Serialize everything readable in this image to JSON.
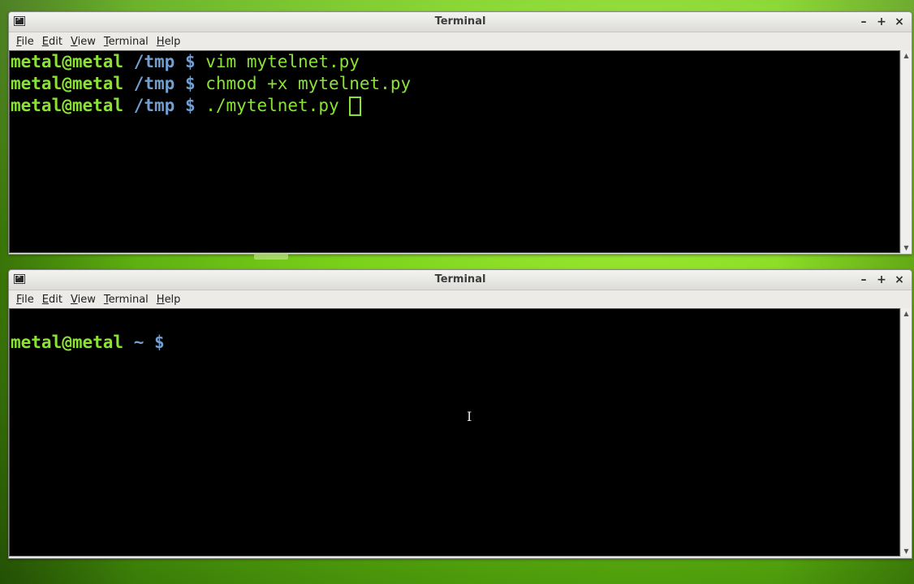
{
  "windows": [
    {
      "title": "Terminal",
      "menu": [
        "File",
        "Edit",
        "View",
        "Terminal",
        "Help"
      ],
      "lines": [
        {
          "user": "metal@metal",
          "path": "/tmp $",
          "cmd": "vim mytelnet.py"
        },
        {
          "user": "metal@metal",
          "path": "/tmp $",
          "cmd": "chmod +x mytelnet.py"
        },
        {
          "user": "metal@metal",
          "path": "/tmp $",
          "cmd": "./mytelnet.py"
        }
      ]
    },
    {
      "title": "Terminal",
      "menu": [
        "File",
        "Edit",
        "View",
        "Terminal",
        "Help"
      ],
      "lines": [
        {
          "user": "metal@metal",
          "path": "~ $",
          "cmd": ""
        }
      ]
    }
  ],
  "window_buttons": {
    "minimize": "–",
    "maximize": "+",
    "close": "×"
  },
  "colors": {
    "prompt_user": "#8ae234",
    "prompt_path": "#729fcf",
    "terminal_bg": "#000000",
    "desktop_green": "#7bd21a"
  },
  "icons": {
    "window_icon": "terminal-icon",
    "mouse_cursor": "ibeam-cursor-icon"
  }
}
